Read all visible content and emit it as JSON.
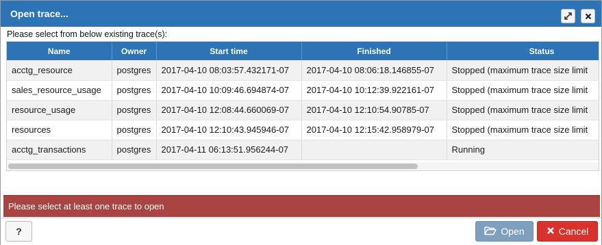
{
  "dialog": {
    "title": "Open trace...",
    "instruction": "Please select from below existing trace(s):",
    "maximize_icon": "expand-icon",
    "close_icon": "close-icon"
  },
  "grid": {
    "columns": [
      "Name",
      "Owner",
      "Start time",
      "Finished",
      "Status"
    ],
    "rows": [
      [
        "acctg_resource",
        "postgres",
        "2017-04-10 08:03:57.432171-07",
        "2017-04-10 08:06:18.146855-07",
        "Stopped (maximum trace size limit"
      ],
      [
        "sales_resource_usage",
        "postgres",
        "2017-04-10 10:09:46.694874-07",
        "2017-04-10 10:12:39.922161-07",
        "Stopped (maximum trace size limit"
      ],
      [
        "resource_usage",
        "postgres",
        "2017-04-10 12:08:44.660069-07",
        "2017-04-10 12:10:54.90785-07",
        "Stopped (maximum trace size limit"
      ],
      [
        "resources",
        "postgres",
        "2017-04-10 12:10:43.945946-07",
        "2017-04-10 12:15:42.958979-07",
        "Stopped (maximum trace size limit"
      ],
      [
        "acctg_transactions",
        "postgres",
        "2017-04-11 06:13:51.956244-07",
        "",
        "Running"
      ]
    ]
  },
  "alert": {
    "message": "Please select at least one trace to open"
  },
  "footer": {
    "help_label": "?",
    "open_label": "Open",
    "cancel_label": "Cancel"
  },
  "colors": {
    "title_bar": "#2c74b6",
    "alert": "#a94442",
    "open_button": "#7f9fbf",
    "cancel_button": "#d9322c"
  }
}
